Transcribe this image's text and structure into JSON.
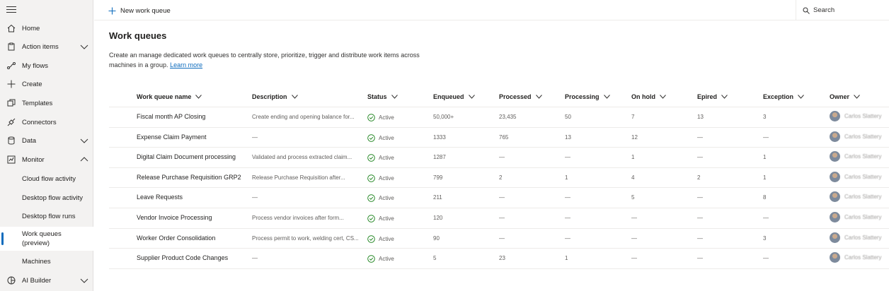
{
  "sidebar": {
    "items": [
      {
        "label": "Home",
        "icon": "home-icon"
      },
      {
        "label": "Action items",
        "icon": "clipboard-icon"
      },
      {
        "label": "My flows",
        "icon": "flow-icon"
      },
      {
        "label": "Create",
        "icon": "plus-icon"
      },
      {
        "label": "Templates",
        "icon": "templates-icon"
      },
      {
        "label": "Connectors",
        "icon": "connector-icon"
      },
      {
        "label": "Data",
        "icon": "database-icon"
      },
      {
        "label": "Monitor",
        "icon": "monitor-icon"
      },
      {
        "label": "Cloud flow activity"
      },
      {
        "label": "Desktop flow activity"
      },
      {
        "label": "Desktop flow runs"
      },
      {
        "label": "Work queues (preview)"
      },
      {
        "label": "Machines"
      },
      {
        "label": "AI Builder",
        "icon": "ai-builder-icon"
      }
    ]
  },
  "topbar": {
    "new_label": "New work queue",
    "search_label": "Search"
  },
  "page": {
    "title": "Work queues",
    "description": "Create an manage dedicated work queues to centrally store, prioritize, trigger and distribute work items across machines in a group.",
    "learn_more": "Learn more"
  },
  "table": {
    "headers": [
      "Work queue name",
      "Description",
      "Status",
      "Enqueued",
      "Processed",
      "Processing",
      "On hold",
      "Epired",
      "Exception",
      "Owner"
    ],
    "rows": [
      {
        "name": "Fiscal month AP Closing",
        "description": "Create ending and opening balance for...",
        "status": "Active",
        "enqueued": "50,000+",
        "processed": "23,435",
        "processing": "50",
        "on_hold": "7",
        "expired": "13",
        "exception": "3",
        "owner": "Carlos Slattery"
      },
      {
        "name": "Expense Claim Payment",
        "description": "—",
        "status": "Active",
        "enqueued": "1333",
        "processed": "765",
        "processing": "13",
        "on_hold": "12",
        "expired": "—",
        "exception": "—",
        "owner": "Carlos Slattery"
      },
      {
        "name": "Digital Claim Document processing",
        "description": "Validated and process extracted claim...",
        "status": "Active",
        "enqueued": "1287",
        "processed": "—",
        "processing": "—",
        "on_hold": "1",
        "expired": "—",
        "exception": "1",
        "owner": "Carlos Slattery"
      },
      {
        "name": "Release Purchase Requisition GRP2",
        "description": "Release Purchase Requisition after...",
        "status": "Active",
        "enqueued": "799",
        "processed": "2",
        "processing": "1",
        "on_hold": "4",
        "expired": "2",
        "exception": "1",
        "owner": "Carlos Slattery"
      },
      {
        "name": "Leave Requests",
        "description": "—",
        "status": "Active",
        "enqueued": "211",
        "processed": "—",
        "processing": "—",
        "on_hold": "5",
        "expired": "—",
        "exception": "8",
        "owner": "Carlos Slattery"
      },
      {
        "name": "Vendor Invoice Processing",
        "description": "Process vendor invoices after form...",
        "status": "Active",
        "enqueued": "120",
        "processed": "—",
        "processing": "—",
        "on_hold": "—",
        "expired": "—",
        "exception": "—",
        "owner": "Carlos Slattery"
      },
      {
        "name": "Worker Order Consolidation",
        "description": "Process permit to work, welding cert, CS...",
        "status": "Active",
        "enqueued": "90",
        "processed": "—",
        "processing": "—",
        "on_hold": "—",
        "expired": "—",
        "exception": "3",
        "owner": "Carlos Slattery"
      },
      {
        "name": "Supplier Product Code Changes",
        "description": "—",
        "status": "Active",
        "enqueued": "5",
        "processed": "23",
        "processing": "1",
        "on_hold": "—",
        "expired": "—",
        "exception": "—",
        "owner": "Carlos Slattery"
      }
    ]
  },
  "colors": {
    "accent": "#0f6cbd",
    "active_status": "#107c10",
    "sidebar_bg": "#f3f2f1"
  }
}
